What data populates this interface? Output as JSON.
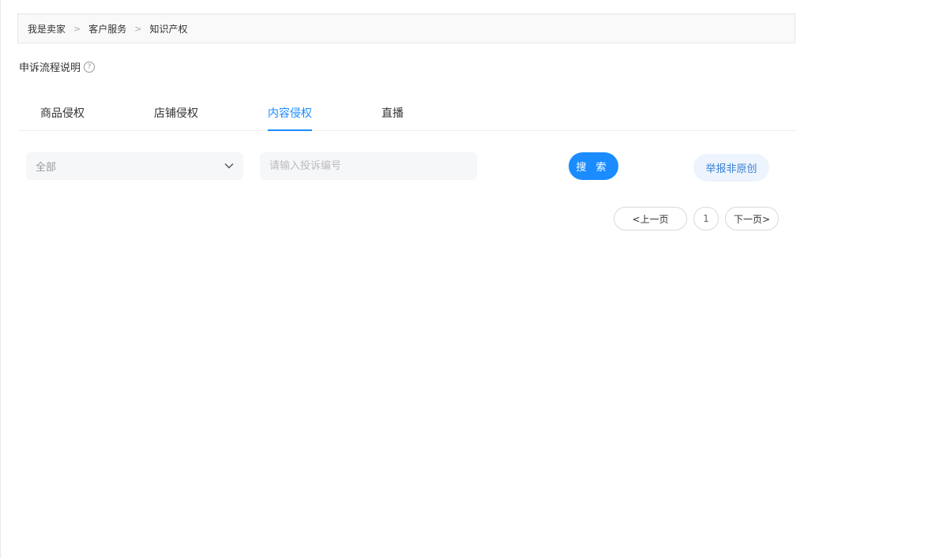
{
  "breadcrumb": {
    "items": [
      "我是卖家",
      "客户服务",
      "知识产权"
    ],
    "separator": ">"
  },
  "flow": {
    "label": "申诉流程说明",
    "help_icon": "help-circle-icon"
  },
  "tabs": [
    {
      "label": "商品侵权",
      "active": false
    },
    {
      "label": "店铺侵权",
      "active": false
    },
    {
      "label": "内容侵权",
      "active": true
    },
    {
      "label": "直播",
      "active": false
    }
  ],
  "filter": {
    "select_value": "全部",
    "chevron_icon": "chevron-down-icon",
    "search_placeholder": "请输入投诉编号",
    "search_value": "",
    "search_label": "搜 索",
    "report_label": "举报非原创"
  },
  "pager": {
    "prev_label": "<上一页",
    "current_page": "1",
    "next_label": "下一页>"
  },
  "colors": {
    "accent": "#1a8cff",
    "report_bg": "#edf4fd",
    "report_text": "#3a7fd5"
  }
}
